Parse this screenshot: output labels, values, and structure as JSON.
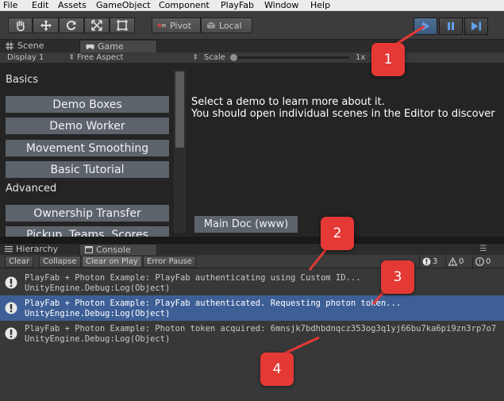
{
  "menu": [
    "File",
    "Edit",
    "Assets",
    "GameObject",
    "Component",
    "PlayFab",
    "Window",
    "Help"
  ],
  "toolbar": {
    "pivot_label": "Pivot",
    "local_label": "Local",
    "tools": [
      "hand-tool",
      "move-tool",
      "rotate-tool",
      "scale-tool",
      "rect-tool"
    ],
    "play_controls": [
      "play",
      "pause",
      "step"
    ],
    "play_active_color": "#3b5a80"
  },
  "tabs": {
    "scene": "Scene",
    "game": "Game"
  },
  "gamebar": {
    "display": "Display 1",
    "aspect": "Free Aspect",
    "scale_label": "Scale",
    "scale_value": "1x"
  },
  "game": {
    "basics_heading": "Basics",
    "basics": [
      "Demo Boxes",
      "Demo Worker",
      "Movement Smoothing",
      "Basic Tutorial"
    ],
    "advanced_heading": "Advanced",
    "advanced": [
      "Ownership Transfer",
      "Pickup, Teams, Scores"
    ],
    "intro_line1": "Select a demo to learn more about it.",
    "intro_line2": "You should open individual scenes in the Editor to discover",
    "main_doc": "Main Doc (www)"
  },
  "lower_tabs": {
    "hierarchy": "Hierarchy",
    "console": "Console"
  },
  "console_toolbar": {
    "clear": "Clear",
    "collapse": "Collapse",
    "clear_on_play": "Clear on Play",
    "error_pause": "Error Pause",
    "warnings_count": "3",
    "errors_count": "0",
    "messages_count": "0"
  },
  "console": {
    "entries": [
      {
        "line1": "PlayFab + Photon Example: PlayFab authenticating using Custom ID...",
        "line2": "UnityEngine.Debug:Log(Object)"
      },
      {
        "line1": "PlayFab + Photon Example: PlayFab authenticated. Requesting photon token...",
        "line2": "UnityEngine.Debug:Log(Object)"
      },
      {
        "line1": "PlayFab + Photon Example: Photon token acquired: 6mnsjk7bdhbdnqcz353og3q1yj66bu7ka6pi9zn3rp7o7",
        "line2": "UnityEngine.Debug:Log(Object)"
      }
    ],
    "selected_index": 1,
    "selected_color": "#3e5f96"
  },
  "annotations": [
    "1",
    "2",
    "3",
    "4"
  ],
  "annotation_color": "#e53935"
}
